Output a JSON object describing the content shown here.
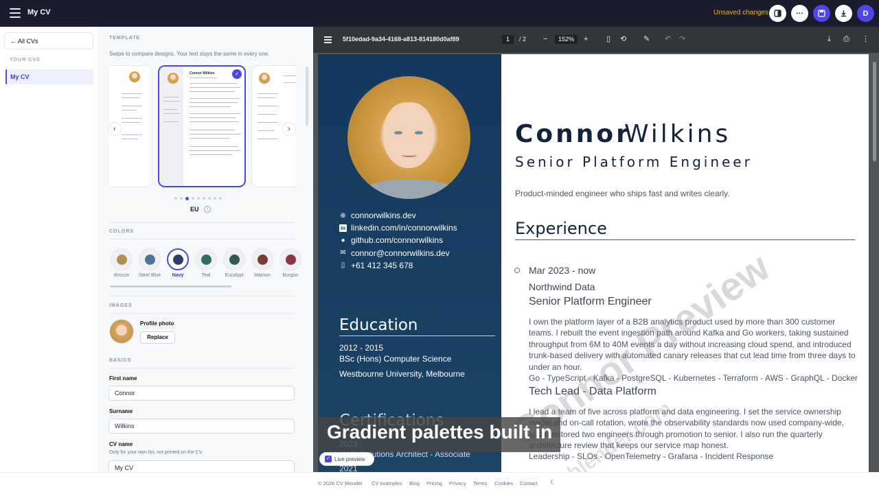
{
  "topbar": {
    "app_title": "My CV",
    "unsaved": "Unsaved changes",
    "avatar_initial": "D",
    "icons": [
      "menu-icon",
      "layout-icon",
      "more-icon",
      "save-icon",
      "download-icon"
    ]
  },
  "leftnav": {
    "all_cvs": "← All CVs",
    "section": "YOUR CVS",
    "items": [
      {
        "label": "My CV",
        "active": true
      }
    ]
  },
  "editor": {
    "template": {
      "label": "TEMPLATE",
      "hint": "Swipe to compare designs. Your text stays the same in every one.",
      "selected_name": "EU",
      "thumbnail_name": "Connor Wilkins",
      "page_count": 9,
      "current_index": 2
    },
    "colors": {
      "label": "COLORS",
      "selected": "Navy",
      "options": [
        {
          "name": "Bronze",
          "hex": "#b0904a"
        },
        {
          "name": "Steel Blue",
          "hex": "#4b7399"
        },
        {
          "name": "Navy",
          "hex": "#2f3f66"
        },
        {
          "name": "Teal",
          "hex": "#2f6f6a"
        },
        {
          "name": "Eucalypt",
          "hex": "#2e5b4b"
        },
        {
          "name": "Maroon",
          "hex": "#7b3a36"
        },
        {
          "name": "Burgun",
          "hex": "#8a3444"
        }
      ]
    },
    "images": {
      "label": "IMAGES",
      "profile_label": "Profile photo",
      "replace": "Replace"
    },
    "basics": {
      "label": "BASICS",
      "first_name_label": "First name",
      "first_name": "Connor",
      "surname_label": "Surname",
      "surname": "Wilkins",
      "cv_name_label": "CV name",
      "cv_name_hint": "Only for your own list, not printed on the CV.",
      "cv_name": "My CV"
    }
  },
  "preview": {
    "doc_id": "5f10edad-9a34-4168-a813-814180d0af89",
    "page_current": "1",
    "page_total": "/ 2",
    "zoom": "152%"
  },
  "cv": {
    "first_name": "Connor",
    "last_name": "Wilkins",
    "role": "Senior Platform Engineer",
    "summary": "Product-minded engineer who ships fast and writes clearly.",
    "contacts": [
      {
        "icon": "globe-icon",
        "glyph": "⊕",
        "text": "connorwilkins.dev"
      },
      {
        "icon": "linkedin-icon",
        "glyph": "in",
        "text": "linkedin.com/in/connorwilkins"
      },
      {
        "icon": "github-icon",
        "glyph": "●",
        "text": "github.com/connorwilkins"
      },
      {
        "icon": "mail-icon",
        "glyph": "✉",
        "text": "connor@connorwilkins.dev"
      },
      {
        "icon": "phone-icon",
        "glyph": "▯",
        "text": "+61 412 345 678"
      }
    ],
    "education_heading": "Education",
    "education_years": "2012 - 2015",
    "education_degree": "BSc (Hons) Computer Science",
    "education_school": "Westbourne University, Melbourne",
    "certifications_heading": "Certifications",
    "cert_year": "2023",
    "cert_name": "AWS Solutions Architect - Associate",
    "cert_year2": "2021",
    "experience_heading": "Experience",
    "job_dates": "Mar 2023 - now",
    "job_company": "Northwind Data",
    "job_title": "Senior Platform Engineer",
    "job_desc": "I own the platform layer of a B2B analytics product used by more than 300 customer teams. I rebuilt the event ingestion path around Kafka and Go workers, taking sustained throughput from 6M to 40M events a day without increasing cloud spend, and introduced trunk-based delivery with automated canary releases that cut lead time from three days to under an hour.",
    "job_tech": "Go - TypeScript - Kafka - PostgreSQL - Kubernetes - Terraform - AWS - GraphQL - Docker",
    "job2_title": "Tech Lead - Data Platform",
    "job2_desc": "I lead a team of five across platform and data engineering. I set the service ownership model and on-call rotation, wrote the observability standards now used company-wide, and mentored two engineers through promotion to senior. I also run the quarterly architecture review that keeps our service map honest.",
    "job2_tech": "Leadership - SLOs - OpenTelemetry - Grafana - Incident Response",
    "watermark": "Connor Preview",
    "watermark2": "cvblender.com"
  },
  "overlay": {
    "caption": "Gradient palettes built in",
    "live_preview": "Live preview"
  },
  "footer": {
    "links": [
      "© 2026 CV Blender",
      "CV examples",
      "Blog",
      "Pricing",
      "Privacy",
      "Terms",
      "Cookies",
      "Contact"
    ]
  }
}
